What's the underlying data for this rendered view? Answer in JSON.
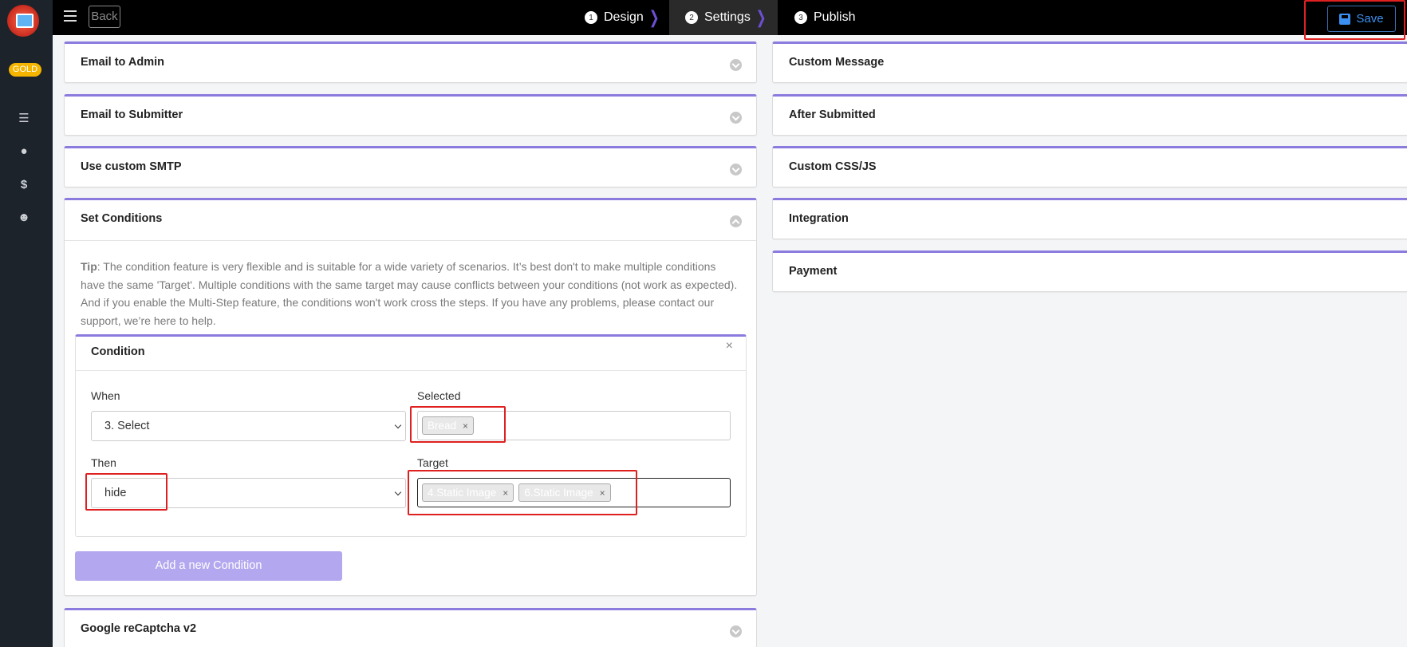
{
  "topbar": {
    "back_label": "Back",
    "steps": [
      {
        "num": "1",
        "label": "Design"
      },
      {
        "num": "2",
        "label": "Settings"
      },
      {
        "num": "3",
        "label": "Publish"
      }
    ],
    "save_label": "Save"
  },
  "sidebar": {
    "badge": "GOLD",
    "icons": [
      "list-icon",
      "user-icon",
      "dollar-icon",
      "smiley-icon"
    ]
  },
  "left_panels": {
    "email_admin": "Email to Admin",
    "email_submitter": "Email to Submitter",
    "smtp": "Use custom SMTP",
    "conditions": "Set Conditions",
    "recaptcha": "Google reCaptcha v2"
  },
  "right_panels": {
    "custom_message": "Custom Message",
    "after_submitted": "After Submitted",
    "custom_css": "Custom CSS/JS",
    "integration": "Integration",
    "payment": "Payment"
  },
  "conditions": {
    "tip_label": "Tip",
    "tip_text": ": The condition feature is very flexible and is suitable for a wide variety of scenarios. It’s best don't to make multiple conditions have the same 'Target'. Multiple conditions with the same target may cause conflicts between your conditions (not work as expected). And if you enable the Multi-Step feature, the conditions won't work cross the steps. If you have any problems, please contact our support, we’re here to help.",
    "box_title": "Condition",
    "close_glyph": "×",
    "when_label": "When",
    "when_value": "3. Select",
    "selected_label": "Selected",
    "selected_tags": [
      "Bread"
    ],
    "then_label": "Then",
    "then_value": "hide",
    "target_label": "Target",
    "target_tags": [
      "4.Static Image",
      "6.Static Image"
    ],
    "tag_remove": "×",
    "add_button": "Add a new Condition"
  },
  "colors": {
    "accent": "#8b7bde",
    "button": "#b3a8ef",
    "highlight": "#e02020",
    "topbar": "#000000",
    "sidebar": "#1d232b",
    "gold_badge": "#f4b400"
  }
}
